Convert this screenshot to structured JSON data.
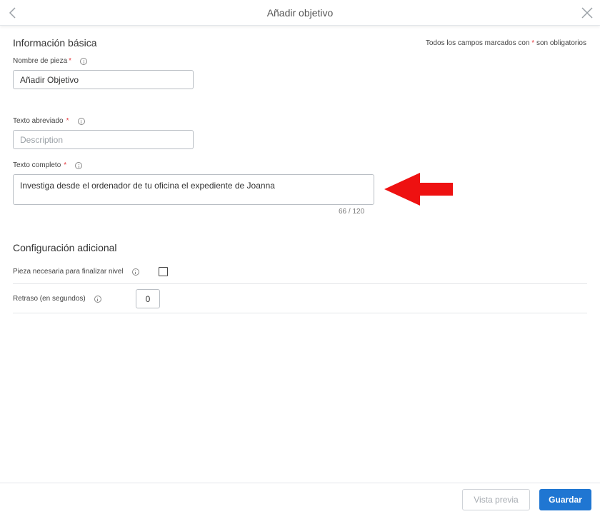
{
  "header": {
    "title": "Añadir objetivo",
    "back_icon": "chevron-left-icon",
    "close_icon": "close-icon"
  },
  "basic_info": {
    "title": "Información básica",
    "required_note_prefix": "Todos los campos marcados con",
    "required_note_star": "*",
    "required_note_suffix": "son obligatorios",
    "piece_name": {
      "label": "Nombre de pieza",
      "required": "*",
      "value": "Añadir Objetivo"
    },
    "short_text": {
      "label": "Texto abreviado",
      "required": "*",
      "value": "",
      "placeholder": "Description"
    },
    "full_text": {
      "label": "Texto completo",
      "required": "*",
      "value": "Investiga desde el ordenador de tu oficina el expediente de Joanna",
      "counter": "66 / 120"
    }
  },
  "annotation": {
    "arrow_color": "#ee1111",
    "arrow_icon": "red-arrow-left-icon"
  },
  "additional_config": {
    "title": "Configuración adicional",
    "required_piece": {
      "label": "Pieza necesaria para finalizar nivel",
      "checked": false
    },
    "delay": {
      "label": "Retraso (en segundos)",
      "value": "0"
    }
  },
  "footer": {
    "preview_label": "Vista previa",
    "save_label": "Guardar",
    "save_color": "#1f76d2"
  }
}
